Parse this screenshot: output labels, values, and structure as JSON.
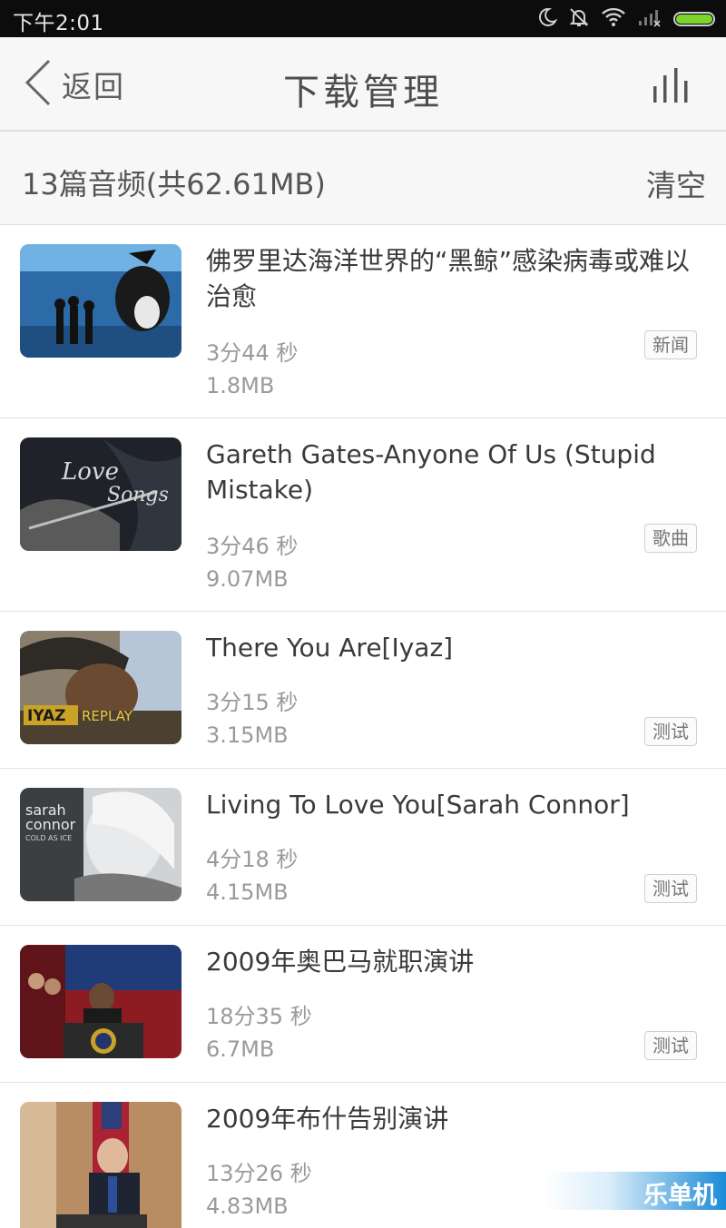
{
  "status_bar": {
    "time": "下午2:01"
  },
  "header": {
    "back_label": "返回",
    "title": "下载管理"
  },
  "summary": {
    "count_text": "13篇音频(共62.61MB)",
    "clear_label": "清空"
  },
  "items": [
    {
      "title": "佛罗里达海洋世界的“黑鲸”感染病毒或难以治愈",
      "duration": "3分44 秒",
      "size": "1.8MB",
      "tag": "新闻"
    },
    {
      "title": "Gareth Gates-Anyone Of Us (Stupid Mistake)",
      "duration": "3分46 秒",
      "size": "9.07MB",
      "tag": "歌曲",
      "thumb_text": [
        "Love",
        "Songs"
      ]
    },
    {
      "title": "There You Are[Iyaz]",
      "duration": "3分15 秒",
      "size": "3.15MB",
      "tag": "测试",
      "thumb_text": [
        "IYAZ",
        "REPLAY"
      ]
    },
    {
      "title": "Living To Love You[Sarah Connor]",
      "duration": "4分18 秒",
      "size": "4.15MB",
      "tag": "测试",
      "thumb_text": [
        "sarah",
        "connor",
        "COLD AS ICE"
      ]
    },
    {
      "title": "2009年奥巴马就职演讲",
      "duration": "18分35 秒",
      "size": "6.7MB",
      "tag": "测试"
    },
    {
      "title": "2009年布什告别演讲",
      "duration": "13分26 秒",
      "size": "4.83MB"
    }
  ],
  "watermark": "乐单机",
  "colors": {
    "battery": "#7cd629",
    "watermark": "#1b8ad6"
  }
}
